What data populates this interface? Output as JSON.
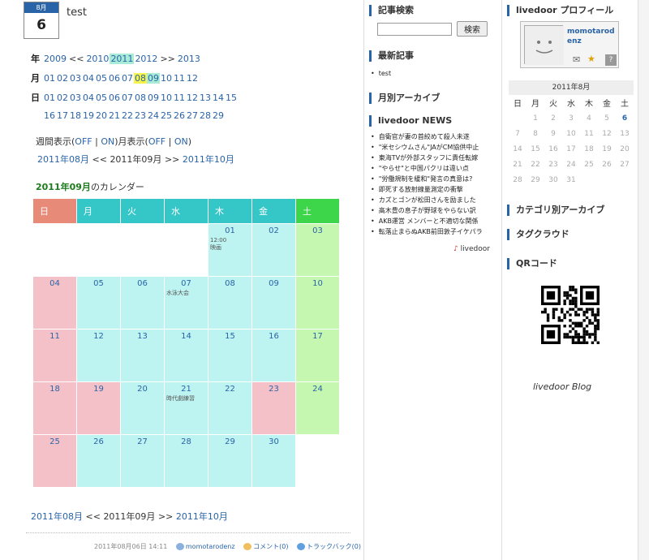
{
  "entry": {
    "month_label": "8月",
    "day": "6",
    "title": "test"
  },
  "year_nav": {
    "label": "年",
    "items": [
      "2009",
      "<<",
      "2010",
      "2011",
      "2012",
      ">>",
      "2013"
    ]
  },
  "month_nav": {
    "label": "月",
    "items": [
      "01",
      "02",
      "03",
      "04",
      "05",
      "06",
      "07",
      "08",
      "09",
      "10",
      "11",
      "12"
    ]
  },
  "day_nav": {
    "label": "日",
    "row1": [
      "01",
      "02",
      "03",
      "04",
      "05",
      "06",
      "07",
      "08",
      "09",
      "10",
      "11",
      "12",
      "13",
      "14",
      "15"
    ],
    "row2": [
      "16",
      "17",
      "18",
      "19",
      "20",
      "21",
      "22",
      "23",
      "24",
      "25",
      "26",
      "27",
      "28",
      "29"
    ]
  },
  "view_toggle": {
    "weekly_label": "週間表示(",
    "weekly_off": "OFF",
    "weekly_sep": "|",
    "weekly_on": "ON",
    "weekly_close": ")",
    "monthly_label": "月表示(",
    "monthly_off": "OFF",
    "monthly_sep": "|",
    "monthly_on": "ON",
    "monthly_close": ")"
  },
  "month_switch": {
    "prev": "2011年08月",
    "prev_arrow": "<<",
    "current": "2011年09月",
    "next_arrow": ">>",
    "next": "2011年10月"
  },
  "calendar": {
    "title_month": "2011年09月",
    "title_suffix": "のカレンダー",
    "weekdays": [
      "日",
      "月",
      "火",
      "水",
      "木",
      "金",
      "土"
    ],
    "weeks": [
      [
        {
          "d": "",
          "t": "empty"
        },
        {
          "d": "",
          "t": "empty"
        },
        {
          "d": "",
          "t": "empty"
        },
        {
          "d": "",
          "t": "empty"
        },
        {
          "d": "01",
          "t": "wd",
          "ev": "12:00\n映画"
        },
        {
          "d": "02",
          "t": "wd"
        },
        {
          "d": "03",
          "t": "sat"
        }
      ],
      [
        {
          "d": "04",
          "t": "sun"
        },
        {
          "d": "05",
          "t": "wd"
        },
        {
          "d": "06",
          "t": "wd"
        },
        {
          "d": "07",
          "t": "wd",
          "ev": "水泳大会"
        },
        {
          "d": "08",
          "t": "wd"
        },
        {
          "d": "09",
          "t": "wd"
        },
        {
          "d": "10",
          "t": "sat"
        }
      ],
      [
        {
          "d": "11",
          "t": "sun"
        },
        {
          "d": "12",
          "t": "wd"
        },
        {
          "d": "13",
          "t": "wd"
        },
        {
          "d": "14",
          "t": "wd"
        },
        {
          "d": "15",
          "t": "wd"
        },
        {
          "d": "16",
          "t": "wd"
        },
        {
          "d": "17",
          "t": "sat"
        }
      ],
      [
        {
          "d": "18",
          "t": "sun"
        },
        {
          "d": "19",
          "t": "hol"
        },
        {
          "d": "20",
          "t": "wd"
        },
        {
          "d": "21",
          "t": "wd",
          "ev": "時代劇練習"
        },
        {
          "d": "22",
          "t": "wd"
        },
        {
          "d": "23",
          "t": "hol"
        },
        {
          "d": "24",
          "t": "sat"
        }
      ],
      [
        {
          "d": "25",
          "t": "sun"
        },
        {
          "d": "26",
          "t": "wd"
        },
        {
          "d": "27",
          "t": "wd"
        },
        {
          "d": "28",
          "t": "wd"
        },
        {
          "d": "29",
          "t": "wd"
        },
        {
          "d": "30",
          "t": "wd"
        },
        {
          "d": "",
          "t": "empty"
        }
      ]
    ]
  },
  "footer": {
    "date": "2011年08月06日 14:11",
    "author": "momotarodenz",
    "comments": "コメント(0)",
    "trackback": "トラックバック(0)"
  },
  "sidebar1": {
    "search_head": "記事検索",
    "search_button": "検索",
    "latest_head": "最新記事",
    "latest_items": [
      "test"
    ],
    "archive_head": "月別アーカイブ",
    "news_head": "livedoor NEWS",
    "news_items": [
      "自衛官が妻の首絞めて殺人未遂",
      "\"米セシウムさん\"JAがCM協供中止",
      "東海TVが外部スタッフに責任転嫁",
      "\"やらせ\"と中国パクリは違い点",
      "\"労働規制を緩和\"発言の真意は?",
      "即死する放射線量測定の衝撃",
      "カズとゴンが松田さんを励ました",
      "高木豊の息子が野球をやらない訳",
      "AKB運営 メンバーと不適切な関係",
      "転落止まらぬAKB前田敦子イケパラ"
    ],
    "news_brand": "livedoor"
  },
  "sidebar2": {
    "profile_head": "livedoor プロフィール",
    "profile_name": "momotarodenz",
    "mini_cal_caption": "2011年8月",
    "mini_weekdays": [
      "日",
      "月",
      "火",
      "水",
      "木",
      "金",
      "土"
    ],
    "mini_weeks": [
      [
        "",
        "1",
        "2",
        "3",
        "4",
        "5",
        "6"
      ],
      [
        "7",
        "8",
        "9",
        "10",
        "11",
        "12",
        "13"
      ],
      [
        "14",
        "15",
        "16",
        "17",
        "18",
        "19",
        "20"
      ],
      [
        "21",
        "22",
        "23",
        "24",
        "25",
        "26",
        "27"
      ],
      [
        "28",
        "29",
        "30",
        "31",
        "",
        "",
        ""
      ]
    ],
    "mini_today": "6",
    "category_head": "カテゴリ別アーカイブ",
    "tag_head": "タグクラウド",
    "qr_head": "QRコード",
    "blog_logo": "livedoor Blog"
  }
}
